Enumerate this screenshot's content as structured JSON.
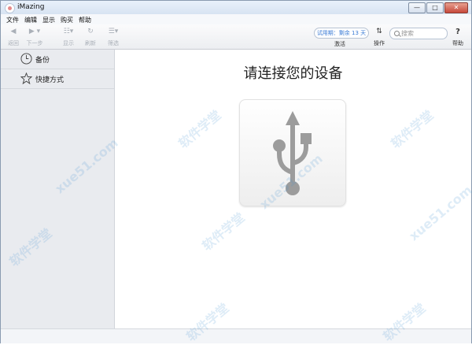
{
  "window": {
    "title": "iMazing",
    "minimize": "—",
    "maximize": "□",
    "close": "✕"
  },
  "menu": [
    "文件",
    "编辑",
    "显示",
    "购买",
    "帮助"
  ],
  "toolbar": {
    "back": "返回",
    "forward": "下一步",
    "view": "显示",
    "refresh": "刷新",
    "filter": "筛选",
    "trial": "试用期：剩余 13 天",
    "activate": "激活",
    "operations": "操作",
    "search_placeholder": "搜索",
    "help": "帮助"
  },
  "sidebar": {
    "items": [
      {
        "label": "备份",
        "icon": "clock-icon"
      },
      {
        "label": "快捷方式",
        "icon": "star-icon"
      }
    ]
  },
  "main": {
    "prompt": "请连接您的设备",
    "icon": "usb-icon"
  },
  "colors": {
    "trial_text": "#3a7bd5",
    "usb_glyph": "#9c9c9c",
    "sidebar_bg": "#e9ebef"
  },
  "watermarks": [
    "软件学堂",
    "xue51.com"
  ]
}
